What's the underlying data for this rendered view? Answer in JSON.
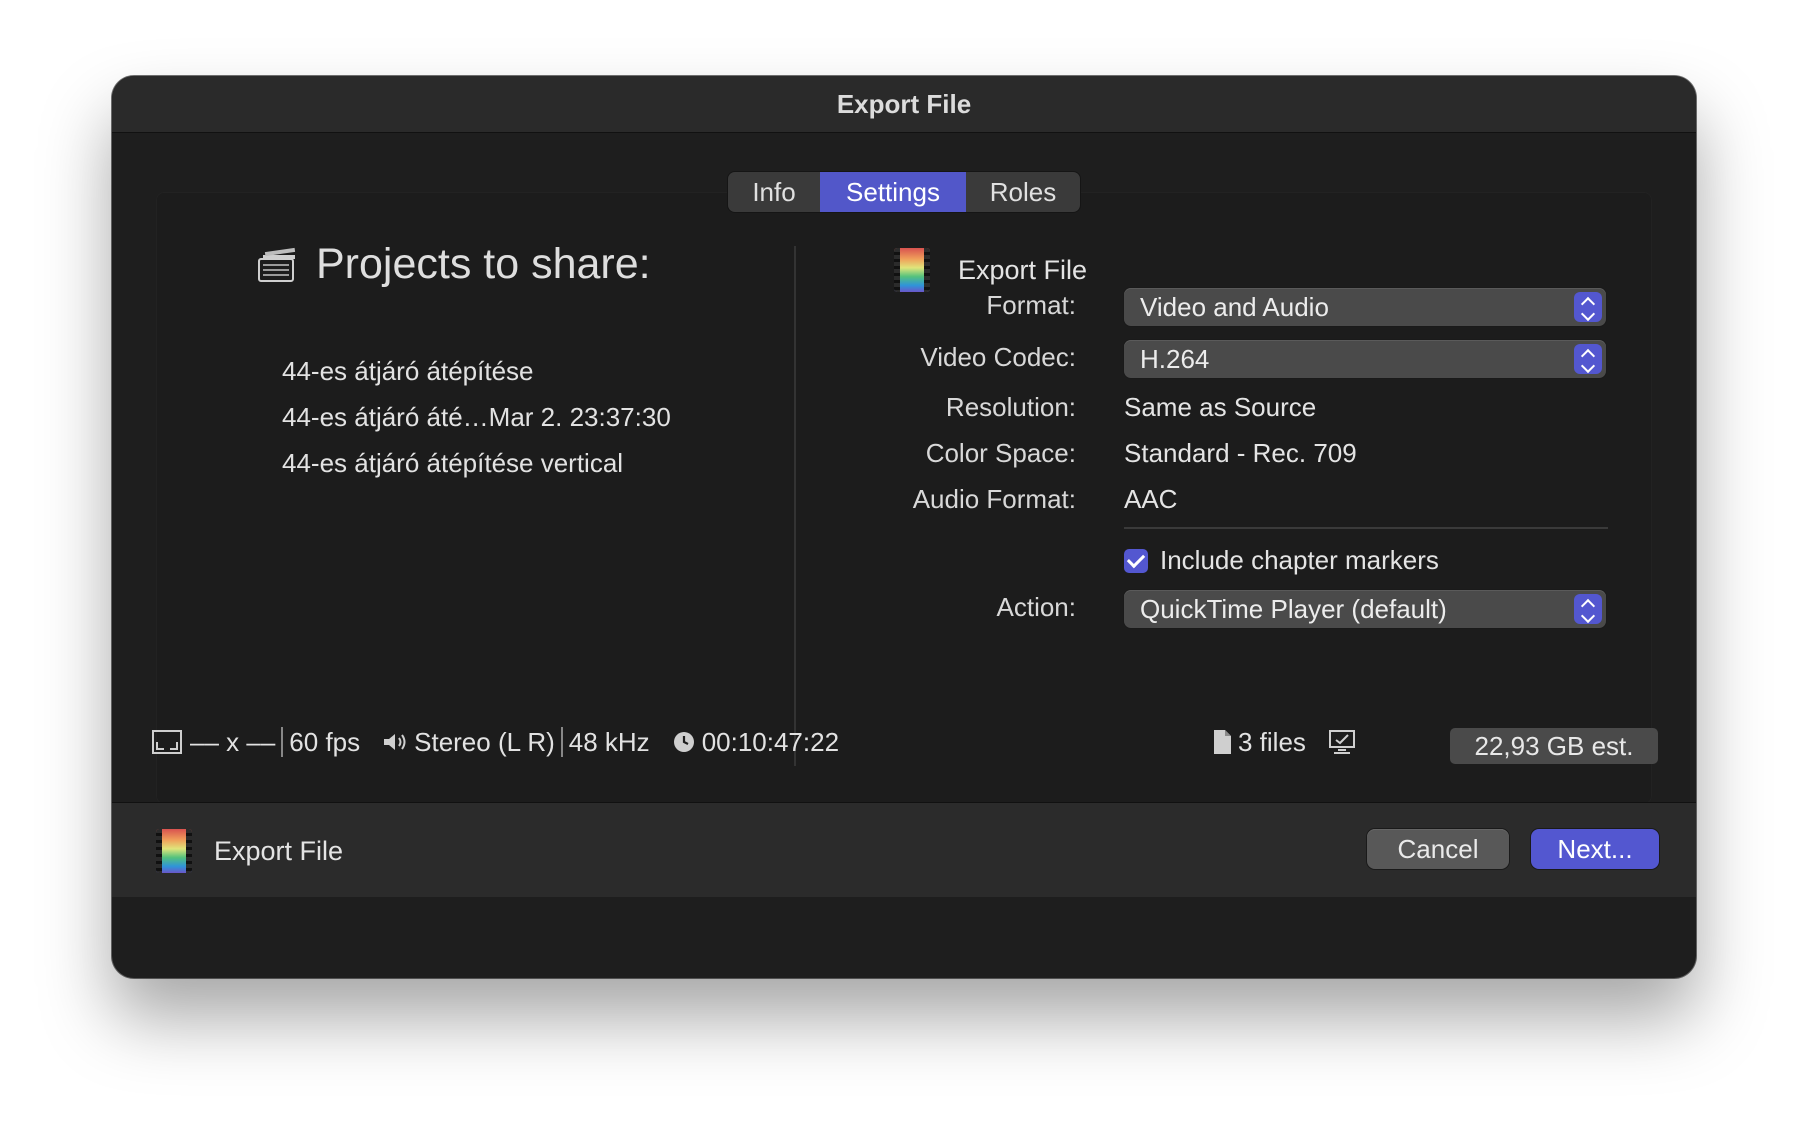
{
  "window": {
    "title": "Export File"
  },
  "tabs": [
    {
      "label": "Info"
    },
    {
      "label": "Settings",
      "selected": true
    },
    {
      "label": "Roles"
    }
  ],
  "left": {
    "heading": "Projects to share:",
    "projects": [
      "44-es átjáró átépítése",
      "44-es átjáró áté…Mar 2. 23:37:30",
      "44-es átjáró átépítése vertical"
    ]
  },
  "right": {
    "heading": "Export File",
    "format_label": "Format:",
    "format_value": "Video and Audio",
    "codec_label": "Video Codec:",
    "codec_value": "H.264",
    "resolution_label": "Resolution:",
    "resolution_value": "Same as Source",
    "colorspace_label": "Color Space:",
    "colorspace_value": "Standard - Rec. 709",
    "audio_label": "Audio Format:",
    "audio_value": "AAC",
    "chapters_label": "Include chapter markers",
    "chapters_checked": true,
    "action_label": "Action:",
    "action_value": "QuickTime Player (default)"
  },
  "status": {
    "dimensions": "–– x ––",
    "fps": "60 fps",
    "audio_channels": "Stereo (L R)",
    "sample_rate": "48 kHz",
    "duration": "00:10:47:22",
    "files": "3 files",
    "size_estimate": "22,93 GB est."
  },
  "footer": {
    "label": "Export File",
    "cancel": "Cancel",
    "next": "Next..."
  },
  "colors": {
    "accent": "#5357d0",
    "window_bg": "#1e1e1e",
    "panel_bg": "#1c1c1c"
  }
}
